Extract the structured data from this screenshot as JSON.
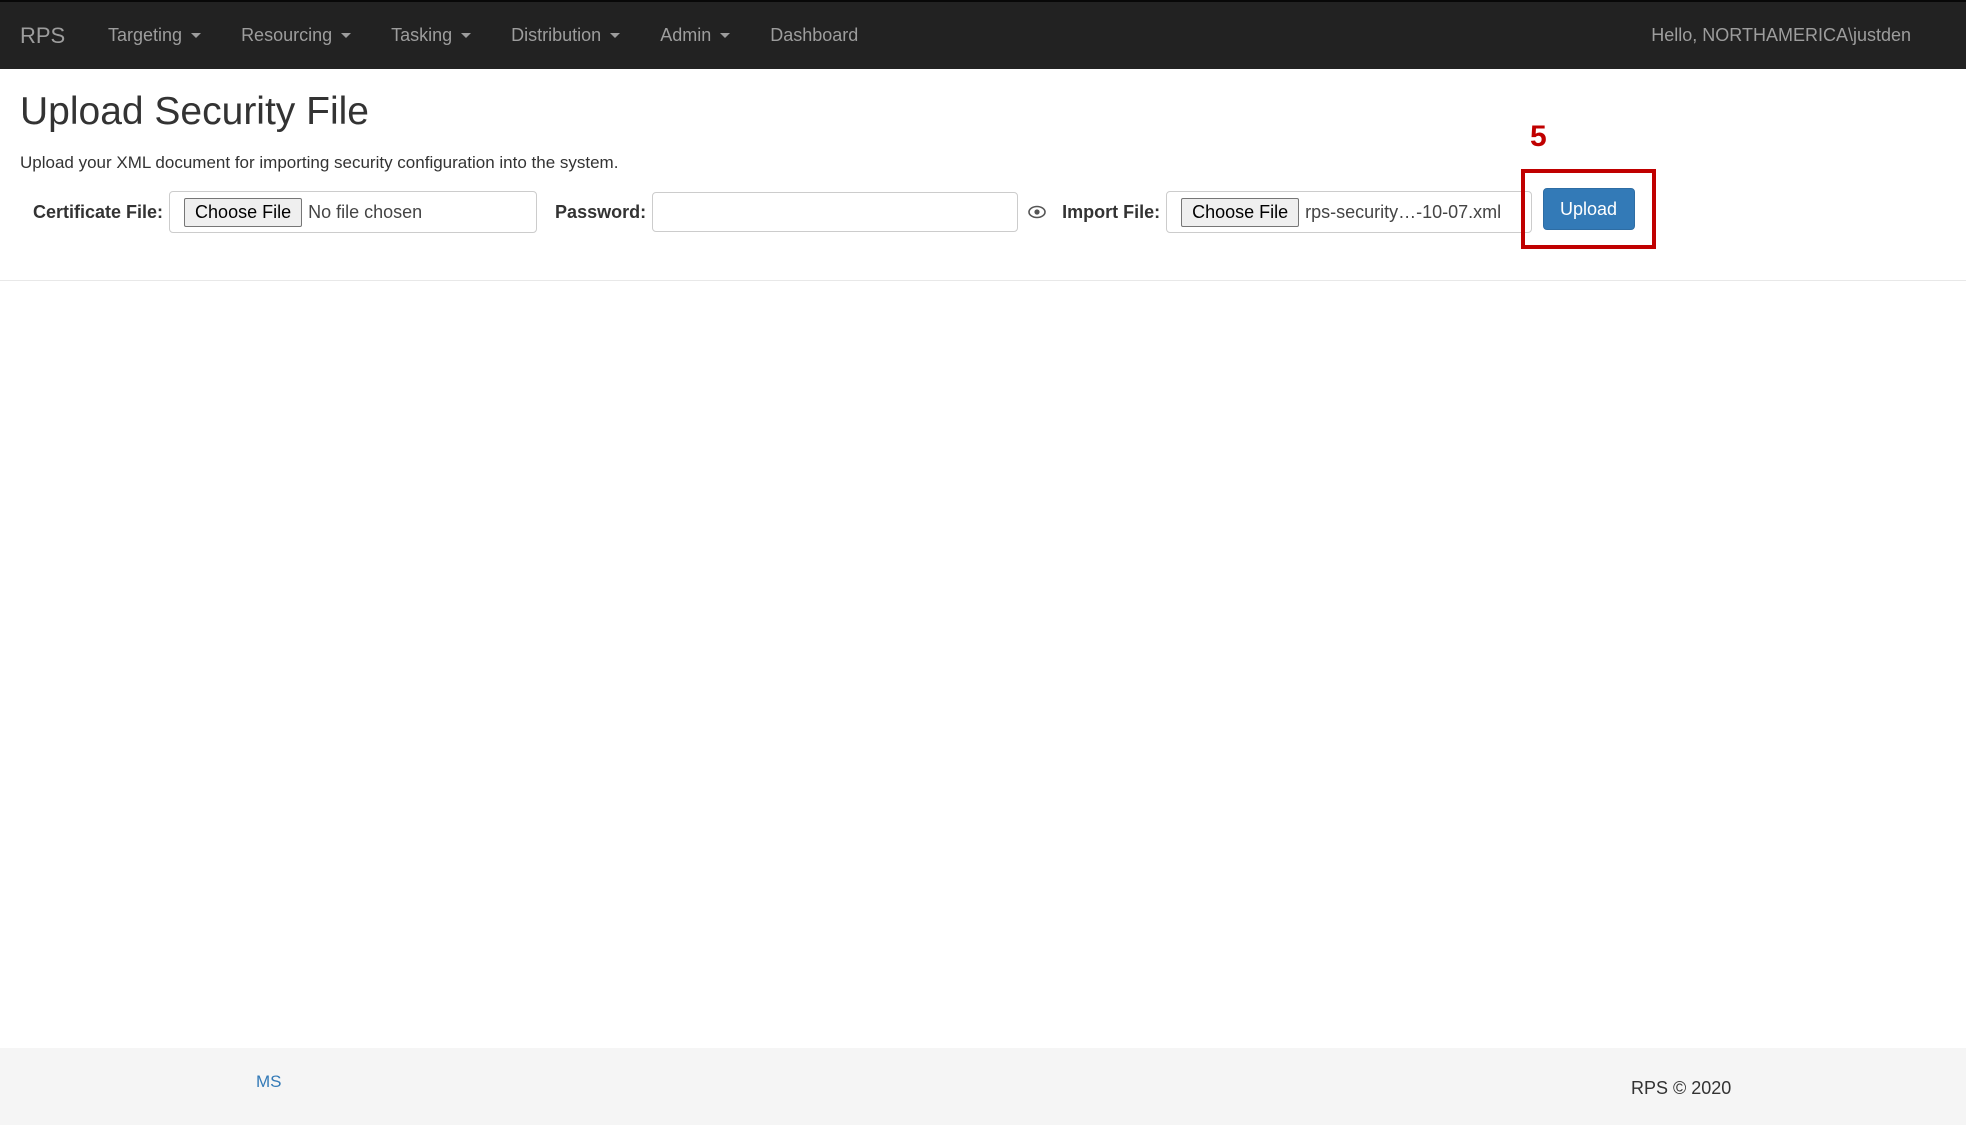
{
  "navbar": {
    "brand": "RPS",
    "items": [
      {
        "label": "Targeting",
        "dropdown": true
      },
      {
        "label": "Resourcing",
        "dropdown": true
      },
      {
        "label": "Tasking",
        "dropdown": true
      },
      {
        "label": "Distribution",
        "dropdown": true
      },
      {
        "label": "Admin",
        "dropdown": true
      },
      {
        "label": "Dashboard",
        "dropdown": false
      }
    ],
    "greeting": "Hello, NORTHAMERICA\\justden"
  },
  "page": {
    "title": "Upload Security File",
    "description": "Upload your XML document for importing security configuration into the system."
  },
  "form": {
    "certificate_label": "Certificate File:",
    "certificate_button": "Choose File",
    "certificate_status": "No file chosen",
    "password_label": "Password:",
    "password_value": "",
    "import_label": "Import File:",
    "import_button": "Choose File",
    "import_status": "rps-security…-10-07.xml",
    "upload_label": "Upload"
  },
  "annotation": {
    "step": "5",
    "color": "#c00000"
  },
  "footer": {
    "link": "MS",
    "copyright": "RPS © 2020"
  },
  "colors": {
    "navbar_bg": "#222222",
    "primary": "#337ab7",
    "annotation": "#c00000"
  }
}
